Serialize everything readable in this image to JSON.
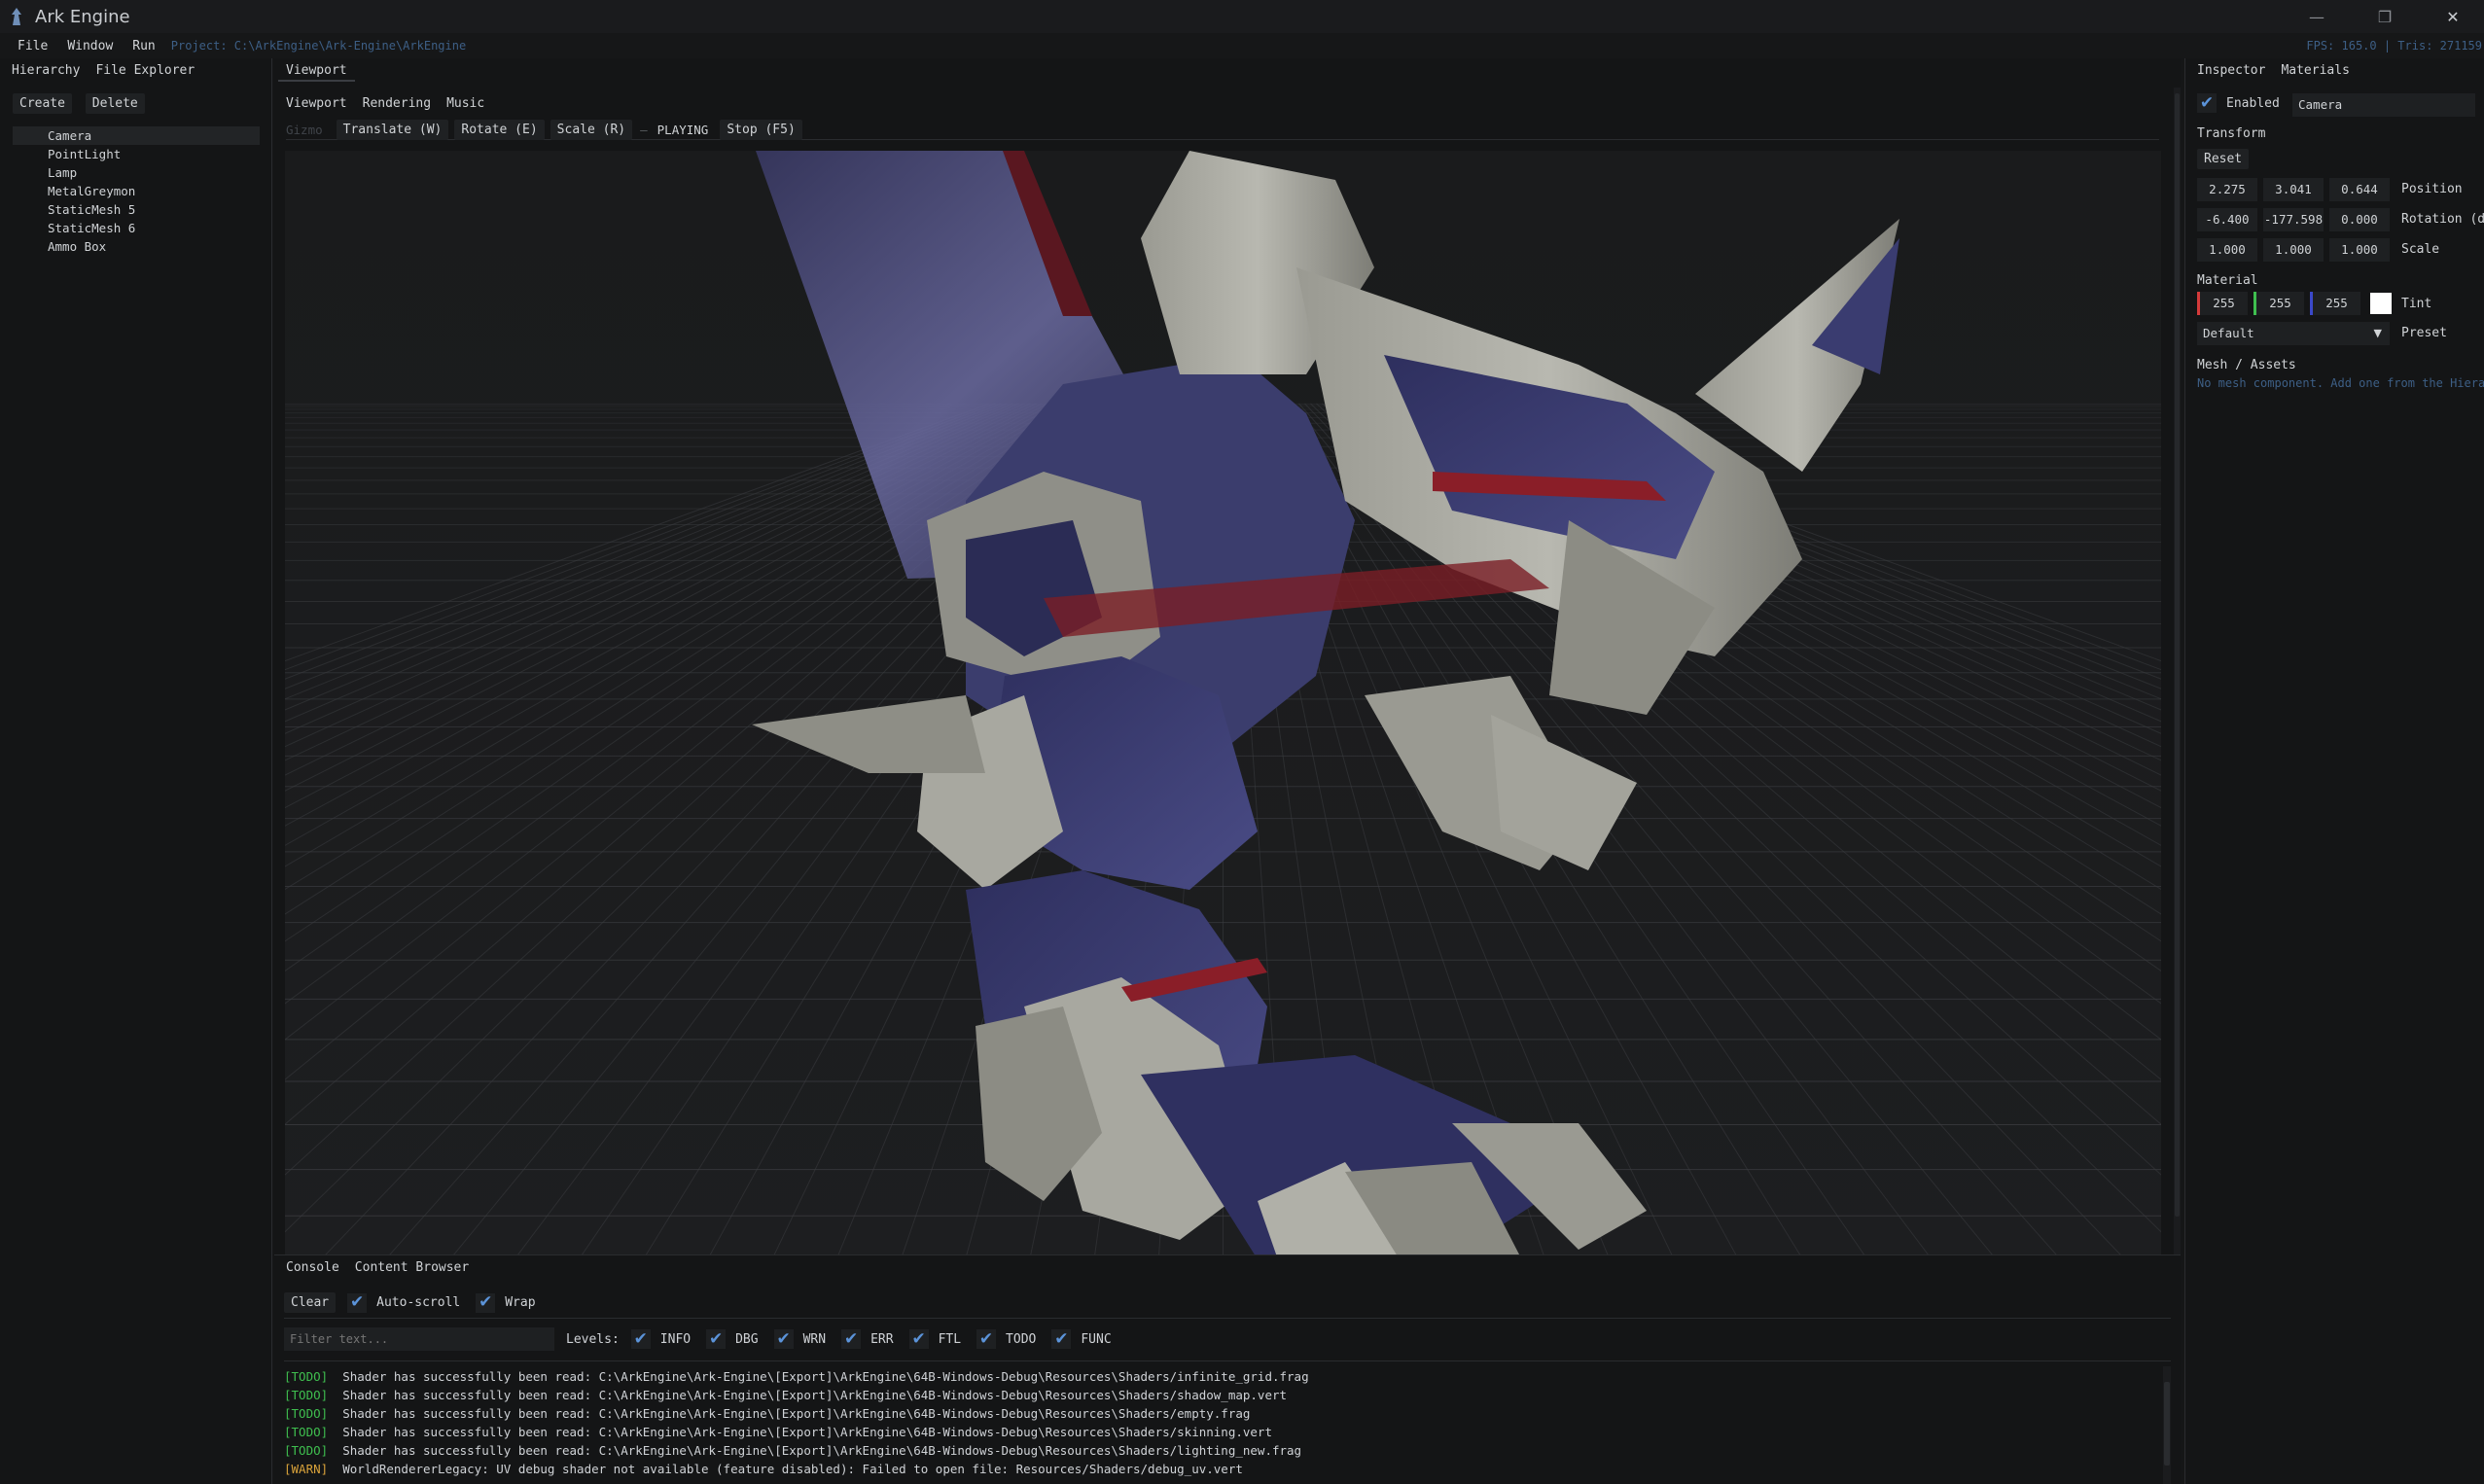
{
  "app": {
    "title": "Ark Engine",
    "icon": "app-logo-icon"
  },
  "window_controls": {
    "minimize": "—",
    "restore": "❐",
    "close": "✕"
  },
  "menubar": {
    "items": [
      "File",
      "Window",
      "Run"
    ],
    "project_path": "Project: C:\\ArkEngine\\Ark-Engine\\ArkEngine",
    "stats": "FPS: 165.0 | Tris: 271159"
  },
  "hierarchy": {
    "tabs": [
      "Hierarchy",
      "File Explorer"
    ],
    "buttons": {
      "create": "Create",
      "delete": "Delete"
    },
    "items": [
      "Camera",
      "PointLight",
      "Lamp",
      "MetalGreymon",
      "StaticMesh 5",
      "StaticMesh 6",
      "Ammo Box"
    ],
    "selected": "Camera"
  },
  "viewport": {
    "panel_tab": "Viewport",
    "sub_tabs": [
      "Viewport",
      "Rendering",
      "Music"
    ],
    "gizmo_label": "Gizmo",
    "tools": [
      "Translate (W)",
      "Rotate (E)",
      "Scale (R)"
    ],
    "separator": "—",
    "state": "PLAYING",
    "stop": "Stop (F5)"
  },
  "inspector": {
    "tabs": [
      "Inspector",
      "Materials"
    ],
    "enabled_label": "Enabled",
    "enabled": true,
    "name_value": "Camera",
    "transform": {
      "title": "Transform",
      "reset": "Reset",
      "position": {
        "label": "Position",
        "values": [
          "2.275",
          "3.041",
          "0.644"
        ]
      },
      "rotation": {
        "label": "Rotation (deg)",
        "values": [
          "-6.400",
          "-177.598",
          "0.000"
        ]
      },
      "scale": {
        "label": "Scale",
        "values": [
          "1.000",
          "1.000",
          "1.000"
        ]
      }
    },
    "material": {
      "title": "Material",
      "tint": {
        "label": "Tint",
        "r": "255",
        "g": "255",
        "b": "255",
        "swatch": "#ffffff"
      },
      "preset": {
        "label": "Preset",
        "value": "Default"
      }
    },
    "mesh": {
      "title": "Mesh / Assets",
      "empty": "No mesh component. Add one from the Hierarchy"
    }
  },
  "console": {
    "tabs": [
      "Console",
      "Content Browser"
    ],
    "clear": "Clear",
    "auto_scroll": "Auto-scroll",
    "wrap": "Wrap",
    "filter_placeholder": "Filter text...",
    "levels_label": "Levels:",
    "levels": [
      "INFO",
      "DBG",
      "WRN",
      "ERR",
      "FTL",
      "TODO",
      "FUNC"
    ],
    "lines": [
      {
        "tag": "[TODO]",
        "text": "Shader has successfully been read: C:\\ArkEngine\\Ark-Engine\\[Export]\\ArkEngine\\64B-Windows-Debug\\Resources\\Shaders/infinite_grid.frag"
      },
      {
        "tag": "[TODO]",
        "text": "Shader has successfully been read: C:\\ArkEngine\\Ark-Engine\\[Export]\\ArkEngine\\64B-Windows-Debug\\Resources\\Shaders/shadow_map.vert"
      },
      {
        "tag": "[TODO]",
        "text": "Shader has successfully been read: C:\\ArkEngine\\Ark-Engine\\[Export]\\ArkEngine\\64B-Windows-Debug\\Resources\\Shaders/empty.frag"
      },
      {
        "tag": "[TODO]",
        "text": "Shader has successfully been read: C:\\ArkEngine\\Ark-Engine\\[Export]\\ArkEngine\\64B-Windows-Debug\\Resources\\Shaders/skinning.vert"
      },
      {
        "tag": "[TODO]",
        "text": "Shader has successfully been read: C:\\ArkEngine\\Ark-Engine\\[Export]\\ArkEngine\\64B-Windows-Debug\\Resources\\Shaders/lighting_new.frag"
      },
      {
        "tag": "[WARN]",
        "text": "WorldRendererLegacy: UV debug shader not available (feature disabled): Failed to open file: Resources/Shaders/debug_uv.vert"
      }
    ]
  },
  "colors": {
    "accent": "#5b93d9",
    "todo": "#3fbf4f",
    "warn": "#d9a23a",
    "project_path": "#3d5f86",
    "tint_r": "#d43a3a",
    "tint_g": "#3fbf4f",
    "tint_b": "#3b48c9"
  }
}
